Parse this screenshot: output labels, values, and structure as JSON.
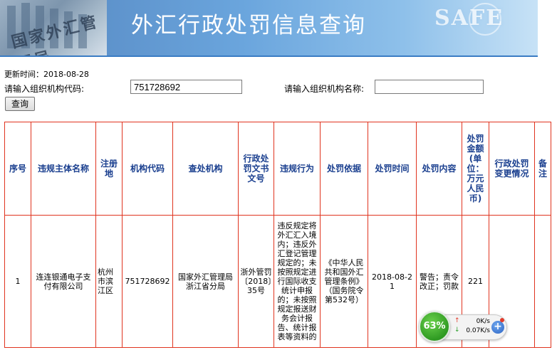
{
  "banner": {
    "title": "外汇行政处罚信息查询",
    "logo_text": "SAFE",
    "building_text": "国家外汇管理局"
  },
  "updated": "更新时间：2018-08-28",
  "search": {
    "code_label": "请输入组织机构代码:",
    "code_value": "751728692",
    "name_label": "请输入组织机构名称:",
    "name_value": "",
    "query_button": "查询"
  },
  "table": {
    "headers": [
      "序号",
      "违规主体名称",
      "注册地",
      "机构代码",
      "查处机构",
      "行政处罚文书文号",
      "违规行为",
      "处罚依据",
      "处罚时间",
      "处罚内容",
      "处罚金额(单位：万元人民币)",
      "行政处罚变更情况",
      "备注"
    ],
    "rows": [
      [
        "1",
        "连连银通电子支付有限公司",
        "杭州市滨江区",
        "751728692",
        "国家外汇管理局浙江省分局",
        "浙外管罚〔2018〕35号",
        "违反规定将外汇汇入境内；违反外汇登记管理规定的；未按照规定进行国际收支统计申报的；未按照规定报送财务会计报告、统计报表等资料的",
        "《中华人民共和国外汇管理条例》（国务院令第532号）",
        "2018-08-21",
        "警告；责令改正；罚款",
        "221",
        "",
        ""
      ]
    ]
  },
  "net_widget": {
    "percent": "63%",
    "upload": "0K/s",
    "download": "0.07K/s",
    "up_arrow": "↑",
    "down_arrow": "↓",
    "plus": "+"
  },
  "colors": {
    "table_border": "#e0341f",
    "header_text": "#1a3f8f",
    "banner_blue": "#5e93cc"
  }
}
